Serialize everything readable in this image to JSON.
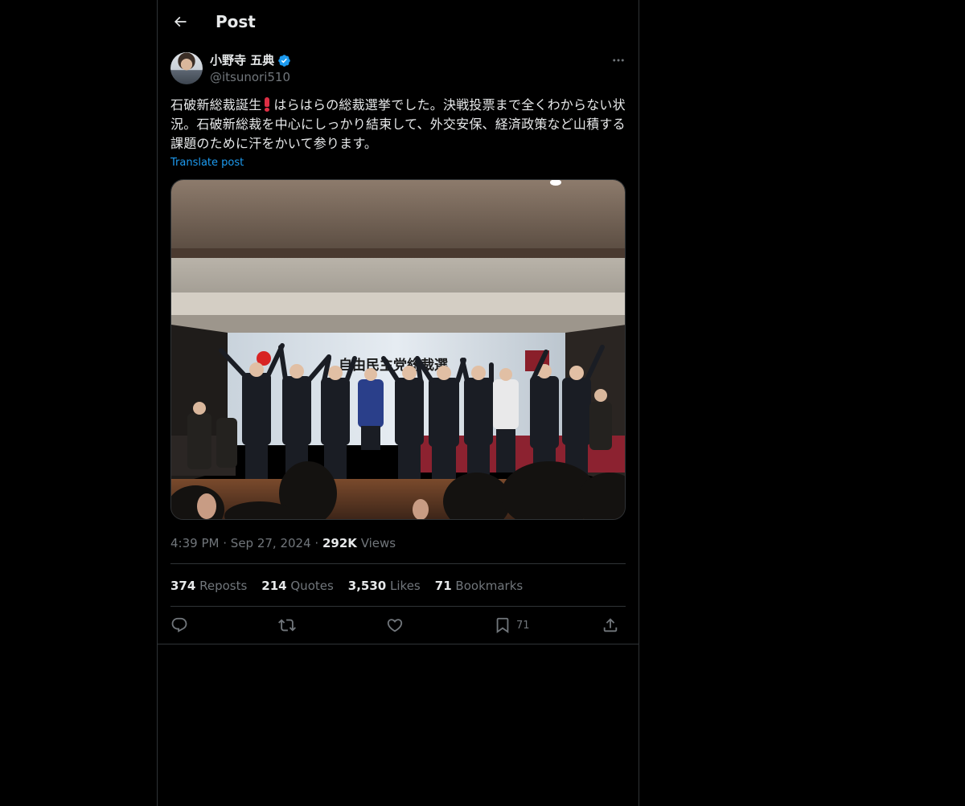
{
  "header": {
    "title": "Post",
    "back_icon": "arrow-left-icon"
  },
  "author": {
    "name": "小野寺 五典",
    "handle": "@itsunori510",
    "verified": true,
    "verified_color": "#1d9bf0"
  },
  "post": {
    "text_part1": "石破新総裁誕生",
    "text_part2": "はらはらの総裁選挙でした。決戦投票まで全くわからない状況。石破新総裁を中心にしっかり結束して、外交安保、経済政策など山積する課題のために汗をかいて参ります。",
    "translate_label": "Translate post",
    "image_banner_text": "自由民主党総裁選"
  },
  "meta": {
    "time": "4:39 PM",
    "date": "Sep 27, 2024",
    "separator": "·",
    "views_count": "292K",
    "views_label": "Views"
  },
  "stats": {
    "reposts_count": "374",
    "reposts_label": "Reposts",
    "quotes_count": "214",
    "quotes_label": "Quotes",
    "likes_count": "3,530",
    "likes_label": "Likes",
    "bookmarks_count": "71",
    "bookmarks_label": "Bookmarks"
  },
  "actions": {
    "reply_icon": "reply-icon",
    "repost_icon": "repost-icon",
    "like_icon": "heart-icon",
    "bookmark_icon": "bookmark-icon",
    "bookmark_count": "71",
    "share_icon": "share-icon"
  },
  "colors": {
    "background": "#000000",
    "text": "#e7e9ea",
    "secondary": "#71767b",
    "accent": "#1d9bf0",
    "border": "#2f3336"
  }
}
